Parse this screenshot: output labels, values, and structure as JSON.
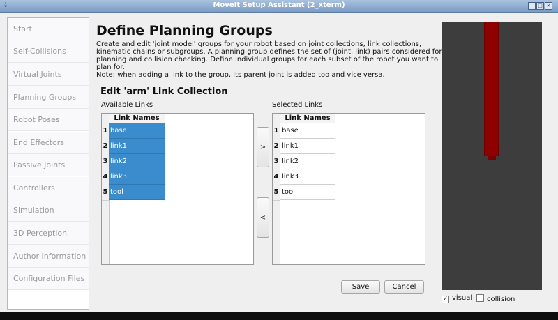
{
  "window": {
    "title": "MoveIt Setup Assistant (2_xterm)",
    "icons": [
      "app-icon",
      "minimize-icon",
      "maximize-icon",
      "close-icon"
    ]
  },
  "sidebar": {
    "items": [
      {
        "label": "Start"
      },
      {
        "label": "Self-Collisions"
      },
      {
        "label": "Virtual Joints"
      },
      {
        "label": "Planning Groups"
      },
      {
        "label": "Robot Poses"
      },
      {
        "label": "End Effectors"
      },
      {
        "label": "Passive Joints"
      },
      {
        "label": "Controllers"
      },
      {
        "label": "Simulation"
      },
      {
        "label": "3D Perception"
      },
      {
        "label": "Author Information"
      },
      {
        "label": "Configuration Files"
      }
    ]
  },
  "main": {
    "title": "Define Planning Groups",
    "description_lines": [
      "Create and edit 'joint model' groups for your robot based on joint collections, link collections,",
      "kinematic chains or subgroups. A planning group defines the set of (joint, link) pairs considered for",
      "planning and collision checking. Define individual groups for each subset of the robot you want to",
      "plan for.",
      "Note: when adding a link to the group, its parent joint is added too and vice versa."
    ],
    "edit_title": "Edit 'arm' Link Collection",
    "available": {
      "label": "Available Links",
      "column": "Link Names",
      "rows": [
        {
          "num": "1",
          "name": "base"
        },
        {
          "num": "2",
          "name": "link1"
        },
        {
          "num": "3",
          "name": "link2"
        },
        {
          "num": "4",
          "name": "link3"
        },
        {
          "num": "5",
          "name": "tool"
        }
      ]
    },
    "selected": {
      "label": "Selected Links",
      "column": "Link Names",
      "rows": [
        {
          "num": "1",
          "name": "base"
        },
        {
          "num": "2",
          "name": "link1"
        },
        {
          "num": "3",
          "name": "link2"
        },
        {
          "num": "4",
          "name": "link3"
        },
        {
          "num": "5",
          "name": "tool"
        }
      ]
    },
    "add_button": ">",
    "remove_button": "<",
    "save_button": "Save",
    "cancel_button": "Cancel"
  },
  "viewer": {
    "visual_label": "visual",
    "visual_checked": true,
    "collision_label": "collision",
    "collision_checked": false,
    "robot_color": "#8f0000",
    "background_color": "#3d3d3d"
  },
  "colors": {
    "selection": "#3b8ccc",
    "titlebar": "#7c9cc4"
  }
}
